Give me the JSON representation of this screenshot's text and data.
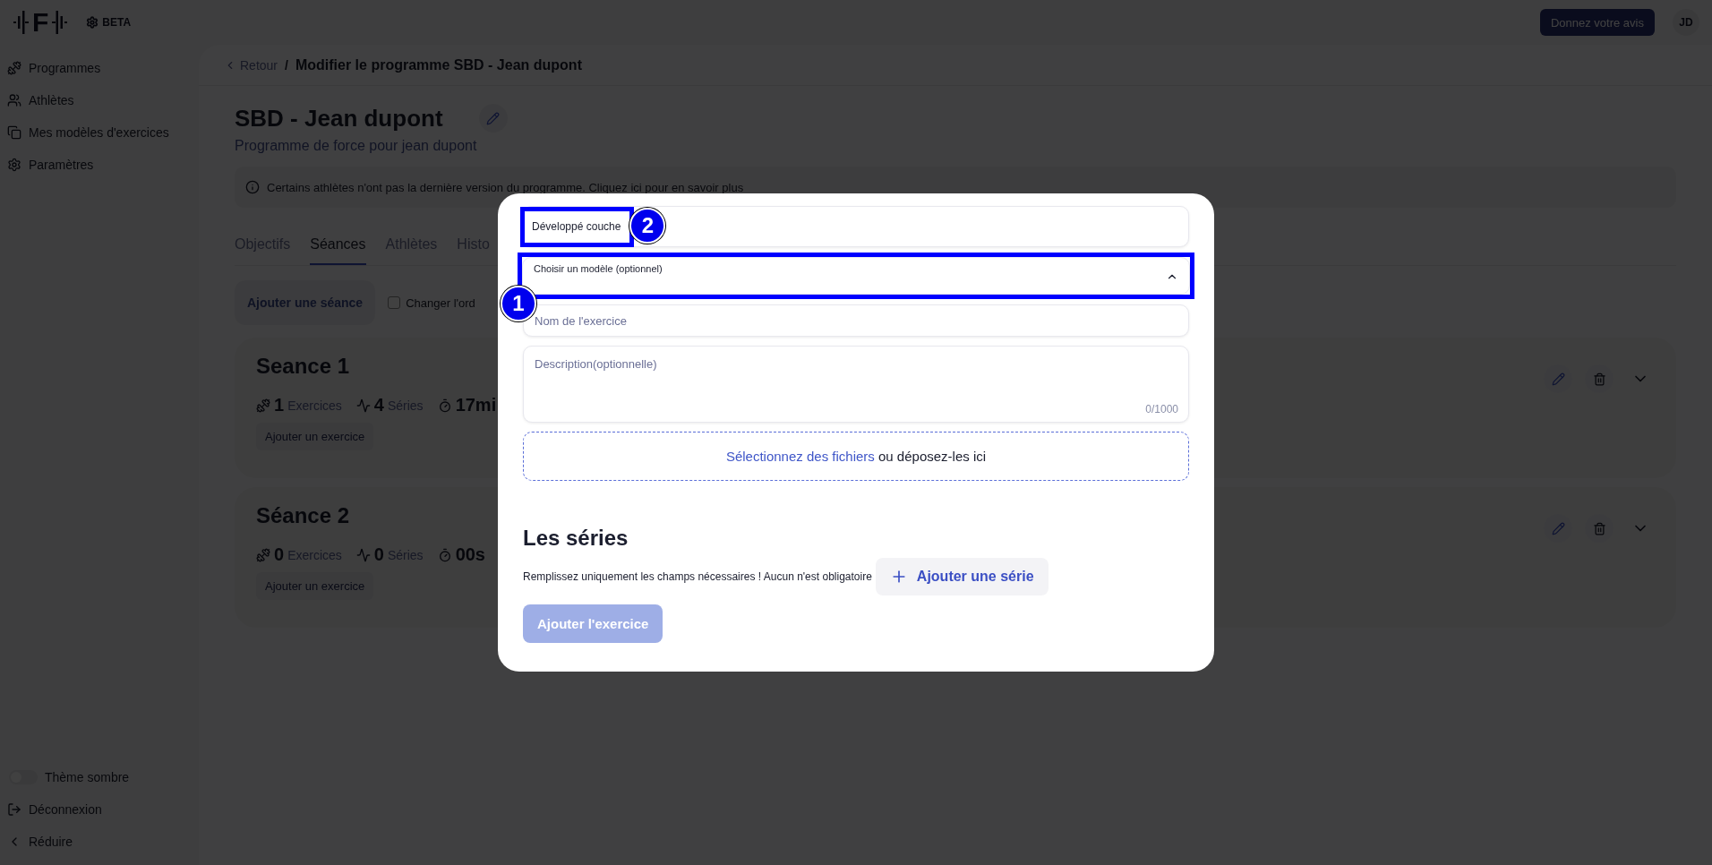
{
  "topbar": {
    "logo_letter": "F",
    "badge": "BETA",
    "feedback_button": "Donnez votre avis",
    "avatar": "JD"
  },
  "sidebar": {
    "items": [
      {
        "label": "Programmes"
      },
      {
        "label": "Athlètes"
      },
      {
        "label": "Mes modèles d'exercices"
      },
      {
        "label": "Paramètres"
      }
    ],
    "theme_toggle": {
      "label": "Thème sombre",
      "on": false
    },
    "logout": "Déconnexion",
    "collapse": "Réduire"
  },
  "main": {
    "breadcrumb": {
      "back": "Retour",
      "separator": "/",
      "current": "Modifier le programme SBD - Jean dupont"
    },
    "title": "SBD - Jean dupont",
    "subtitle": "Programme de force pour jean dupont",
    "notice": "Certains athlètes n'ont pas la dernière version du programme. Cliquez ici pour en savoir plus",
    "tabs": [
      {
        "label": "Objectifs",
        "selected": false
      },
      {
        "label": "Séances",
        "selected": true
      },
      {
        "label": "Athlètes",
        "selected": false
      },
      {
        "label": "Histo",
        "selected": false
      }
    ],
    "add_session_button": "Ajouter une séance",
    "reorder": {
      "label": "Changer l'ord",
      "checked": false
    },
    "sessions": [
      {
        "title": "Seance 1",
        "exercises_count": "1",
        "exercises_label": "Exercices",
        "series_count": "4",
        "series_label": "Séries",
        "duration": "17mi",
        "add_button": "Ajouter un exercice"
      },
      {
        "title": "Séance 2",
        "exercises_count": "0",
        "exercises_label": "Exercices",
        "series_count": "0",
        "series_label": "Séries",
        "duration": "00s",
        "add_button": "Ajouter un exercice"
      }
    ]
  },
  "modal": {
    "exercise_value": "Développé couche",
    "template_select": {
      "label": "Choisir un modèle (optionnel)",
      "expanded": true
    },
    "name_placeholder": "Nom de l'exercice",
    "description_placeholder": "Description(optionnelle)",
    "counter": "0/1000",
    "dropzone": {
      "link": "Sélectionnez des fichiers",
      "text": "ou déposez-les ici"
    },
    "series_heading": "Les séries",
    "series_hint": "Remplissez uniquement les champs nécessaires ! Aucun n'est obligatoire",
    "add_series_button": "Ajouter une série",
    "submit": {
      "label": "Ajouter l'exercice",
      "disabled": true
    },
    "annotations": [
      {
        "label": "2"
      },
      {
        "label": "1"
      }
    ]
  }
}
